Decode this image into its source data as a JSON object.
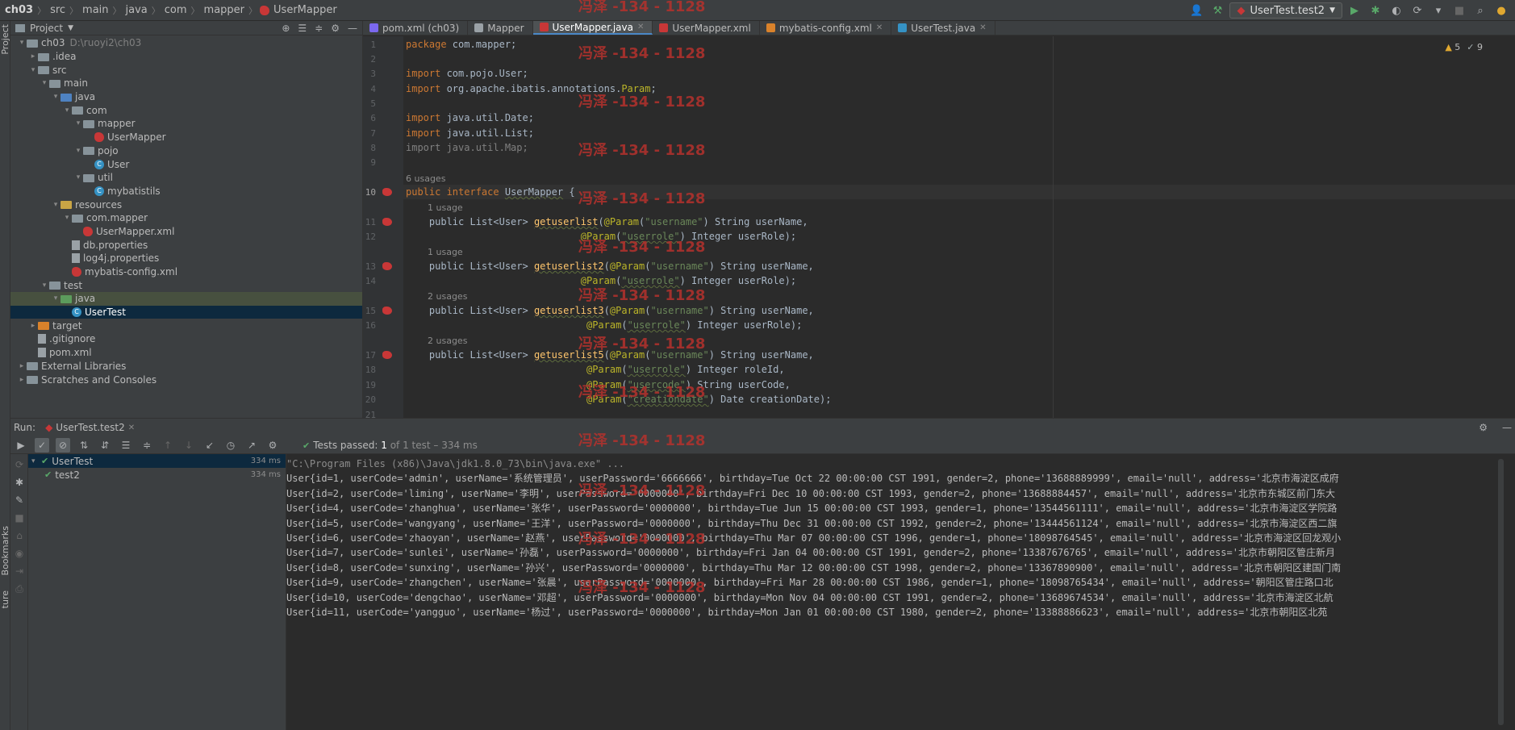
{
  "navbar": {
    "crumbs": [
      "ch03",
      "src",
      "main",
      "java",
      "com",
      "mapper",
      "UserMapper"
    ],
    "run_config": "UserTest.test2"
  },
  "left_strip": {
    "project_label": "Project",
    "bookmarks_label": "Bookmarks",
    "structure_label": "ture"
  },
  "project_panel": {
    "title": "Project",
    "tree": [
      {
        "label": "ch03",
        "hint": "D:\\ruoyi2\\ch03",
        "depth": 0,
        "arrow": "▾",
        "icon": "folder"
      },
      {
        "label": ".idea",
        "depth": 1,
        "arrow": "▸",
        "icon": "folder"
      },
      {
        "label": "src",
        "depth": 1,
        "arrow": "▾",
        "icon": "folder"
      },
      {
        "label": "main",
        "depth": 2,
        "arrow": "▾",
        "icon": "folder"
      },
      {
        "label": "java",
        "depth": 3,
        "arrow": "▾",
        "icon": "folder-blue"
      },
      {
        "label": "com",
        "depth": 4,
        "arrow": "▾",
        "icon": "folder"
      },
      {
        "label": "mapper",
        "depth": 5,
        "arrow": "▾",
        "icon": "folder"
      },
      {
        "label": "UserMapper",
        "depth": 6,
        "arrow": "",
        "icon": "bird"
      },
      {
        "label": "pojo",
        "depth": 5,
        "arrow": "▾",
        "icon": "folder"
      },
      {
        "label": "User",
        "depth": 6,
        "arrow": "",
        "icon": "class"
      },
      {
        "label": "util",
        "depth": 5,
        "arrow": "▾",
        "icon": "folder"
      },
      {
        "label": "mybatistils",
        "depth": 6,
        "arrow": "",
        "icon": "class"
      },
      {
        "label": "resources",
        "depth": 3,
        "arrow": "▾",
        "icon": "folder-res"
      },
      {
        "label": "com.mapper",
        "depth": 4,
        "arrow": "▾",
        "icon": "folder"
      },
      {
        "label": "UserMapper.xml",
        "depth": 5,
        "arrow": "",
        "icon": "bird"
      },
      {
        "label": "db.properties",
        "depth": 4,
        "arrow": "",
        "icon": "file"
      },
      {
        "label": "log4j.properties",
        "depth": 4,
        "arrow": "",
        "icon": "file"
      },
      {
        "label": "mybatis-config.xml",
        "depth": 4,
        "arrow": "",
        "icon": "bird"
      },
      {
        "label": "test",
        "depth": 2,
        "arrow": "▾",
        "icon": "folder"
      },
      {
        "label": "java",
        "depth": 3,
        "arrow": "▾",
        "icon": "folder-green",
        "state": "highlight"
      },
      {
        "label": "UserTest",
        "depth": 4,
        "arrow": "",
        "icon": "class",
        "state": "selected"
      },
      {
        "label": "target",
        "depth": 1,
        "arrow": "▸",
        "icon": "folder-orange"
      },
      {
        "label": ".gitignore",
        "depth": 1,
        "arrow": "",
        "icon": "file"
      },
      {
        "label": "pom.xml",
        "depth": 1,
        "arrow": "",
        "icon": "file"
      },
      {
        "label": "External Libraries",
        "depth": 0,
        "arrow": "▸",
        "icon": "folder"
      },
      {
        "label": "Scratches and Consoles",
        "depth": 0,
        "arrow": "▸",
        "icon": "folder"
      }
    ]
  },
  "editor": {
    "tabs": [
      {
        "label": "pom.xml (ch03)",
        "active": false,
        "closable": false,
        "color": "#7b68ee"
      },
      {
        "label": "Mapper",
        "active": false,
        "closable": false,
        "color": "#9aa1a6"
      },
      {
        "label": "UserMapper.java",
        "active": true,
        "closable": true,
        "color": "#c83737"
      },
      {
        "label": "UserMapper.xml",
        "active": false,
        "closable": false,
        "color": "#c83737"
      },
      {
        "label": "mybatis-config.xml",
        "active": false,
        "closable": true,
        "color": "#d9822b"
      },
      {
        "label": "UserTest.java",
        "active": false,
        "closable": true,
        "color": "#3592c4"
      }
    ],
    "warnings": "5",
    "ok_count": "9",
    "line_numbers": [
      "1",
      "2",
      "3",
      "4",
      "5",
      "6",
      "7",
      "8",
      "9",
      "10",
      "11",
      "12",
      "13",
      "14",
      "15",
      "16",
      "17",
      "18",
      "19",
      "20",
      "21"
    ],
    "hints": {
      "h10": "6 usages",
      "h11": "1 usage",
      "h13": "1 usage",
      "h15": "2 usages",
      "h17": "2 usages"
    },
    "code": {
      "l1_kw": "package",
      "l1_rest": " com.mapper;",
      "l3_kw": "import",
      "l3_rest": " com.pojo.User;",
      "l4_kw": "import",
      "l4_rest": " org.apache.ibatis.annotations.",
      "l4_ann": "Param",
      "l4_end": ";",
      "l6_kw": "import",
      "l6_rest": " java.util.Date;",
      "l7_kw": "import",
      "l7_rest": " java.util.List;",
      "l8_text": "import java.util.Map;",
      "l10_kw1": "public",
      "l10_kw2": " interface ",
      "l10_name": "UserMapper",
      "l10_end": " {",
      "l11_a": "    public List<User> ",
      "l11_fn": "getuserlist",
      "l11_b": "(",
      "l11_ann": "@Param",
      "l11_c": "(",
      "l11_str": "\"username\"",
      "l11_d": ") String userName,",
      "l12_pad": "                              ",
      "l12_ann": "@Param",
      "l12_c": "(",
      "l12_str": "\"userrole\"",
      "l12_d": ") Integer userRole);",
      "l13_a": "    public List<User> ",
      "l13_fn": "getuserlist2",
      "l13_b": "(",
      "l13_ann": "@Param",
      "l13_c": "(",
      "l13_str": "\"username\"",
      "l13_d": ") String userName,",
      "l14_pad": "                              ",
      "l14_ann": "@Param",
      "l14_c": "(",
      "l14_str": "\"userrole\"",
      "l14_d": ") Integer userRole);",
      "l15_a": "    public List<User> ",
      "l15_fn": "getuserlist3",
      "l15_b": "(",
      "l15_ann": "@Param",
      "l15_c": "(",
      "l15_str": "\"username\"",
      "l15_d": ") String userName,",
      "l16_pad": "                               ",
      "l16_ann": "@Param",
      "l16_c": "(",
      "l16_str": "\"userrole\"",
      "l16_d": ") Integer userRole);",
      "l17_a": "    public List<User> ",
      "l17_fn": "getuserlist5",
      "l17_b": "(",
      "l17_ann": "@Param",
      "l17_c": "(",
      "l17_str": "\"username\"",
      "l17_d": ") String userName,",
      "l18_pad": "                               ",
      "l18_ann": "@Param",
      "l18_c": "(",
      "l18_str": "\"userrole\"",
      "l18_d": ") Integer roleId,",
      "l19_pad": "                               ",
      "l19_ann": "@Param",
      "l19_c": "(",
      "l19_str": "\"usercode\"",
      "l19_d": ") String userCode,",
      "l20_pad": "                               ",
      "l20_ann": "@Param",
      "l20_c": "(",
      "l20_str": "\"creationdate\"",
      "l20_d": ") Date creationDate);"
    }
  },
  "watermark": "冯泽 -134 - 1128",
  "run_panel": {
    "label": "Run:",
    "tab": "UserTest.test2",
    "status_prefix": "Tests passed: ",
    "status_count": "1",
    "status_suffix": " of 1 test – 334 ms",
    "tests": [
      {
        "label": "UserTest",
        "duration": "334 ms",
        "selected": true,
        "depth": 0
      },
      {
        "label": "test2",
        "duration": "334 ms",
        "selected": false,
        "depth": 1
      }
    ],
    "console": [
      "\"C:\\Program Files (x86)\\Java\\jdk1.8.0_73\\bin\\java.exe\" ...",
      "User{id=1, userCode='admin', userName='系统管理员', userPassword='6666666', birthday=Tue Oct 22 00:00:00 CST 1991, gender=2, phone='13688889999', email='null', address='北京市海淀区成府",
      "User{id=2, userCode='liming', userName='李明', userPassword='0000000', birthday=Fri Dec 10 00:00:00 CST 1993, gender=2, phone='13688884457', email='null', address='北京市东城区前门东大",
      "User{id=4, userCode='zhanghua', userName='张华', userPassword='0000000', birthday=Tue Jun 15 00:00:00 CST 1993, gender=1, phone='13544561111', email='null', address='北京市海淀区学院路",
      "User{id=5, userCode='wangyang', userName='王洋', userPassword='0000000', birthday=Thu Dec 31 00:00:00 CST 1992, gender=2, phone='13444561124', email='null', address='北京市海淀区西二旗",
      "User{id=6, userCode='zhaoyan', userName='赵燕', userPassword='0000000', birthday=Thu Mar 07 00:00:00 CST 1996, gender=1, phone='18098764545', email='null', address='北京市海淀区回龙观小",
      "User{id=7, userCode='sunlei', userName='孙磊', userPassword='0000000', birthday=Fri Jan 04 00:00:00 CST 1991, gender=2, phone='13387676765', email='null', address='北京市朝阳区管庄新月",
      "User{id=8, userCode='sunxing', userName='孙兴', userPassword='0000000', birthday=Thu Mar 12 00:00:00 CST 1998, gender=2, phone='13367890900', email='null', address='北京市朝阳区建国门南",
      "User{id=9, userCode='zhangchen', userName='张晨', userPassword='0000000', birthday=Fri Mar 28 00:00:00 CST 1986, gender=1, phone='18098765434', email='null', address='朝阳区管庄路口北",
      "User{id=10, userCode='dengchao', userName='邓超', userPassword='0000000', birthday=Mon Nov 04 00:00:00 CST 1991, gender=2, phone='13689674534', email='null', address='北京市海淀区北航",
      "User{id=11, userCode='yangguo', userName='杨过', userPassword='0000000', birthday=Mon Jan 01 00:00:00 CST 1980, gender=2, phone='13388886623', email='null', address='北京市朝阳区北苑"
    ]
  }
}
